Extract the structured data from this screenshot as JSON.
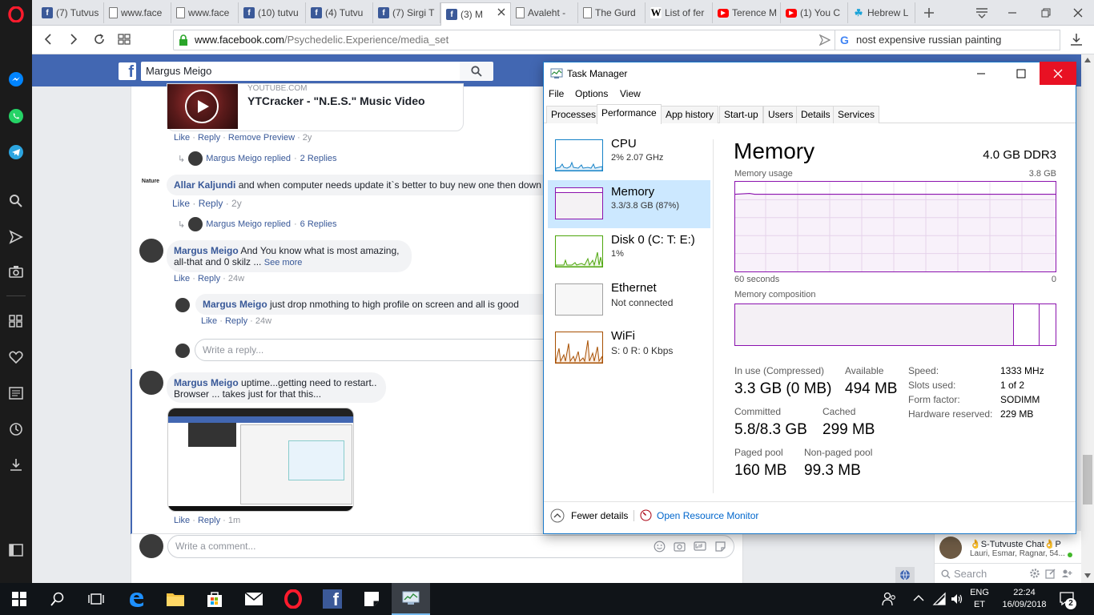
{
  "browser": {
    "tabs": [
      {
        "label": "(7) Tutvus",
        "fav": "facebook"
      },
      {
        "label": "www.face",
        "fav": "page"
      },
      {
        "label": "www.face",
        "fav": "page"
      },
      {
        "label": "(10) tutvu",
        "fav": "facebook"
      },
      {
        "label": "(4) Tutvu",
        "fav": "facebook"
      },
      {
        "label": "(7) Sirgi T",
        "fav": "facebook"
      },
      {
        "label": "(3) M",
        "fav": "facebook"
      },
      {
        "label": "Avaleht -",
        "fav": "page"
      },
      {
        "label": "The Gurd",
        "fav": "page"
      },
      {
        "label": "List of fer",
        "fav": "wikipedia"
      },
      {
        "label": "Terence M",
        "fav": "youtube"
      },
      {
        "label": "(1) You C",
        "fav": "youtube"
      },
      {
        "label": "Hebrew L",
        "fav": "leaf"
      }
    ],
    "url_domain": "www.facebook.com",
    "url_path": "/Psychedelic.Experience/media_set",
    "search_text": "nost expensive russian painting"
  },
  "facebook": {
    "search_value": "Margus Meigo",
    "preview_domain": "YOUTUBE.COM",
    "preview_title": "YTCracker - \"N.E.S.\" Music Video",
    "preview_actions": {
      "like": "Like",
      "reply": "Reply",
      "remove": "Remove Preview",
      "time": "2y"
    },
    "replied_1": {
      "name": "Margus Meigo replied",
      "count": "2 Replies"
    },
    "comment_allar": {
      "name": "Allar Kaljundi",
      "text": "and when computer needs update it`s better to buy new one then down",
      "avatar_text": "Nature",
      "like": "Like",
      "reply": "Reply",
      "time": "2y"
    },
    "replied_2": {
      "name": "Margus Meigo replied",
      "count": "6 Replies"
    },
    "comment_m1": {
      "name": "Margus Meigo",
      "text1": "And You know what is most amazing,",
      "text2": "all-that and 0 skilz ...",
      "see_more": "See more",
      "like": "Like",
      "reply": "Reply",
      "time": "24w"
    },
    "reply_m1": {
      "name": "Margus Meigo",
      "text": "just drop nmothing to high profile on screen and all is good",
      "like": "Like",
      "reply": "Reply",
      "time": "24w"
    },
    "write_reply": "Write a reply...",
    "comment_m2": {
      "name": "Margus Meigo",
      "text1": "uptime...getting need to restart..",
      "text2": "Browser ... takes just for that this...",
      "like": "Like",
      "reply": "Reply",
      "time": "1m"
    },
    "write_comment": "Write a comment...",
    "chat": {
      "title": "👌S-Tutvuste Chat👌P",
      "members": "Lauri, Esmar, Ragnar, 54...",
      "search": "Search"
    }
  },
  "taskmanager": {
    "title": "Task Manager",
    "menu": [
      "File",
      "Options",
      "View"
    ],
    "tabs": [
      "Processes",
      "Performance",
      "App history",
      "Start-up",
      "Users",
      "Details",
      "Services"
    ],
    "resources": [
      {
        "name": "CPU",
        "sub": "2%  2.07 GHz",
        "color": "#1582c7"
      },
      {
        "name": "Memory",
        "sub": "3.3/3.8 GB (87%)",
        "color": "#8b12ae"
      },
      {
        "name": "Disk 0 (C: T: E:)",
        "sub": "1%",
        "color": "#4da60c"
      },
      {
        "name": "Ethernet",
        "sub": "Not connected",
        "color": "#a0a0a0"
      },
      {
        "name": "WiFi",
        "sub": "S: 0  R: 0 Kbps",
        "color": "#a74f01"
      }
    ],
    "heading": "Memory",
    "spec": "4.0 GB DDR3",
    "usage_label": "Memory usage",
    "usage_max": "3.8 GB",
    "axis_left": "60 seconds",
    "axis_right": "0",
    "usage_percent": 87,
    "composition_label": "Memory composition",
    "stats": {
      "in_use_label": "In use (Compressed)",
      "in_use": "3.3 GB (0 MB)",
      "available_label": "Available",
      "available": "494 MB",
      "committed_label": "Committed",
      "committed": "5.8/8.3 GB",
      "cached_label": "Cached",
      "cached": "299 MB",
      "paged_label": "Paged pool",
      "paged": "160 MB",
      "nonpaged_label": "Non-paged pool",
      "nonpaged": "99.3 MB"
    },
    "details": [
      {
        "k": "Speed:",
        "v": "1333 MHz"
      },
      {
        "k": "Slots used:",
        "v": "1 of 2"
      },
      {
        "k": "Form factor:",
        "v": "SODIMM"
      },
      {
        "k": "Hardware reserved:",
        "v": "229 MB"
      }
    ],
    "fewer_details": "Fewer details",
    "resource_monitor": "Open Resource Monitor"
  },
  "taskbar": {
    "lang1": "ENG",
    "lang2": "ET",
    "time": "22:24",
    "date": "16/09/2018",
    "notifications": "2"
  }
}
